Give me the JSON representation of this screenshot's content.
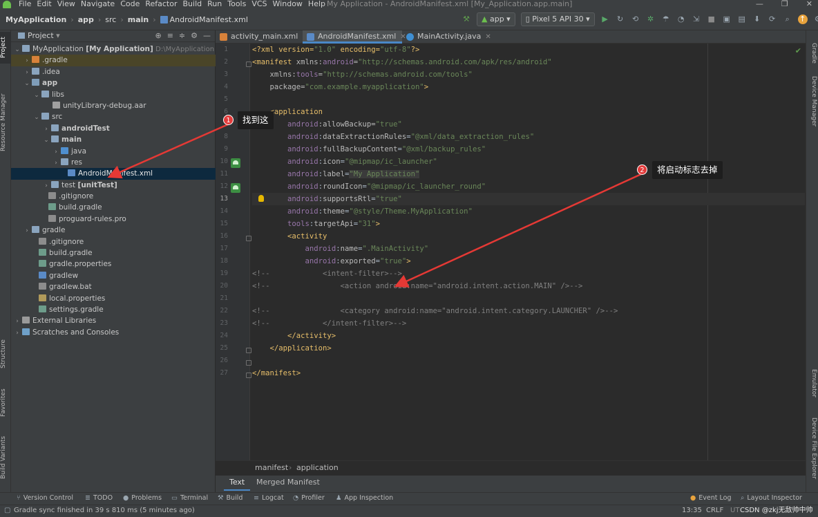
{
  "menubar": {
    "items": [
      "File",
      "Edit",
      "View",
      "Navigate",
      "Code",
      "Refactor",
      "Build",
      "Run",
      "Tools",
      "VCS",
      "Window",
      "Help"
    ],
    "window_title": "My Application - AndroidManifest.xml [My_Application.app.main]"
  },
  "navbar": {
    "crumbs": [
      "MyApplication",
      "app",
      "src",
      "main",
      "AndroidManifest.xml"
    ],
    "run_config": "app",
    "device": "Pixel 5 API 30"
  },
  "project_panel": {
    "title": "Project",
    "tree": [
      {
        "label": "MyApplication",
        "bold": "[My Application]",
        "dim": "D:\\MyApplication",
        "icon": "folder-icon"
      },
      {
        "label": ".gradle",
        "icon": "folder-icon"
      },
      {
        "label": ".idea",
        "icon": "folder-icon"
      },
      {
        "label": "app",
        "icon": "module-icon"
      },
      {
        "label": "libs",
        "icon": "folder-icon"
      },
      {
        "label": "unityLibrary-debug.aar",
        "icon": "archive-icon"
      },
      {
        "label": "src",
        "icon": "folder-icon"
      },
      {
        "label": "androidTest",
        "icon": "folder-icon"
      },
      {
        "label": "main",
        "icon": "folder-icon"
      },
      {
        "label": "java",
        "icon": "folder-icon"
      },
      {
        "label": "res",
        "icon": "folder-icon"
      },
      {
        "label": "AndroidManifest.xml",
        "icon": "manifest-icon"
      },
      {
        "label": "test",
        "bold": "[unitTest]",
        "icon": "folder-icon"
      },
      {
        "label": ".gitignore",
        "icon": "file-icon"
      },
      {
        "label": "build.gradle",
        "icon": "gradle-icon"
      },
      {
        "label": "proguard-rules.pro",
        "icon": "file-icon"
      },
      {
        "label": "gradle",
        "icon": "folder-icon"
      },
      {
        "label": ".gitignore",
        "icon": "file-icon"
      },
      {
        "label": "build.gradle",
        "icon": "gradle-icon"
      },
      {
        "label": "gradle.properties",
        "icon": "gradle-icon"
      },
      {
        "label": "gradlew",
        "icon": "file-icon"
      },
      {
        "label": "gradlew.bat",
        "icon": "file-icon"
      },
      {
        "label": "local.properties",
        "icon": "file-icon"
      },
      {
        "label": "settings.gradle",
        "icon": "gradle-icon"
      },
      {
        "label": "External Libraries",
        "icon": "library-icon"
      },
      {
        "label": "Scratches and Consoles",
        "icon": "scratch-icon"
      }
    ]
  },
  "left_strip": [
    "Project",
    "Resource Manager",
    "Structure",
    "Favorites",
    "Build Variants"
  ],
  "right_strip": [
    "Gradle",
    "Device Manager",
    "Emulator",
    "Device File Explorer"
  ],
  "editor_tabs": [
    "activity_main.xml",
    "AndroidManifest.xml",
    "MainActivity.java"
  ],
  "line_numbers": [
    "1",
    "2",
    "3",
    "4",
    "5",
    "6",
    "7",
    "8",
    "9",
    "10",
    "11",
    "12",
    "13",
    "14",
    "15",
    "16",
    "17",
    "18",
    "19",
    "20",
    "21",
    "22",
    "23",
    "24",
    "25",
    "26",
    "27"
  ],
  "code": {
    "l1": {
      "a": "<?xml version=",
      "b": "\"1.0\"",
      "c": " encoding=",
      "d": "\"utf-8\"",
      "e": "?>"
    },
    "l2": {
      "a": "<manifest ",
      "b": "xmlns:",
      "c": "android",
      "d": "=",
      "e": "\"http://schemas.android.com/apk/res/android\""
    },
    "l3": {
      "a": "    xmlns:",
      "b": "tools",
      "c": "=",
      "d": "\"http://schemas.android.com/tools\""
    },
    "l4": {
      "a": "    package=",
      "b": "\"com.example.myapplication\"",
      "c": ">"
    },
    "l6": "    <application",
    "l7": {
      "ns": "android",
      ":": ":",
      "attr": "allowBackup",
      "eq": "=",
      "val": "\"true\""
    },
    "l8": {
      "ns": "android",
      "attr": "dataExtractionRules",
      "val": "\"@xml/data_extraction_rules\""
    },
    "l9": {
      "ns": "android",
      "attr": "fullBackupContent",
      "val": "\"@xml/backup_rules\""
    },
    "l10": {
      "ns": "android",
      "attr": "icon",
      "val": "\"@mipmap/ic_launcher\""
    },
    "l11": {
      "ns": "android",
      "attr": "label",
      "val": "\"My Application\""
    },
    "l12": {
      "ns": "android",
      "attr": "roundIcon",
      "val": "\"@mipmap/ic_launcher_round\""
    },
    "l13": {
      "ns": "android",
      "attr": "supportsRtl",
      "val": "\"true\""
    },
    "l14": {
      "ns": "android",
      "attr": "theme",
      "val": "\"@style/Theme.MyApplication\""
    },
    "l15": {
      "ns": "tools",
      "attr": "targetApi",
      "val": "\"31\"",
      "end": ">"
    },
    "l16": "        <activity",
    "l17": {
      "ns": "android",
      "attr": "name",
      "val": "\".MainActivity\""
    },
    "l18": {
      "ns": "android",
      "attr": "exported",
      "val": "\"true\"",
      "end": ">"
    },
    "l19": "<!--            <intent-filter>-->",
    "l20": "<!--                <action android:name=\"android.intent.action.MAIN\" />-->",
    "l22": "<!--                <category android:name=\"android.intent.category.LAUNCHER\" />-->",
    "l23": "<!--            </intent-filter>-->",
    "l24": "        </activity>",
    "l25": "    </application>",
    "l27": "</manifest>"
  },
  "editor_breadcrumb": [
    "manifest",
    "application"
  ],
  "editor_bottom_tabs": [
    "Text",
    "Merged Manifest"
  ],
  "tool_windows": [
    "Version Control",
    "TODO",
    "Problems",
    "Terminal",
    "Build",
    "Logcat",
    "Profiler",
    "App Inspection"
  ],
  "tool_windows_right": [
    "Event Log",
    "Layout Inspector"
  ],
  "status": {
    "message": "Gradle sync finished in 39 s 810 ms (5 minutes ago)",
    "position": "13:35",
    "line_sep": "CRLF",
    "encoding": "UTF-8",
    "watermark": "CSDN @zkj无敌帅中帅"
  },
  "callouts": [
    {
      "num": "1",
      "text": "找到这"
    },
    {
      "num": "2",
      "text": "将启动标志去掉"
    }
  ],
  "colors": {
    "accent": "#4a88c7",
    "callout_red": "#e33b3b",
    "selection": "#0d293e"
  }
}
